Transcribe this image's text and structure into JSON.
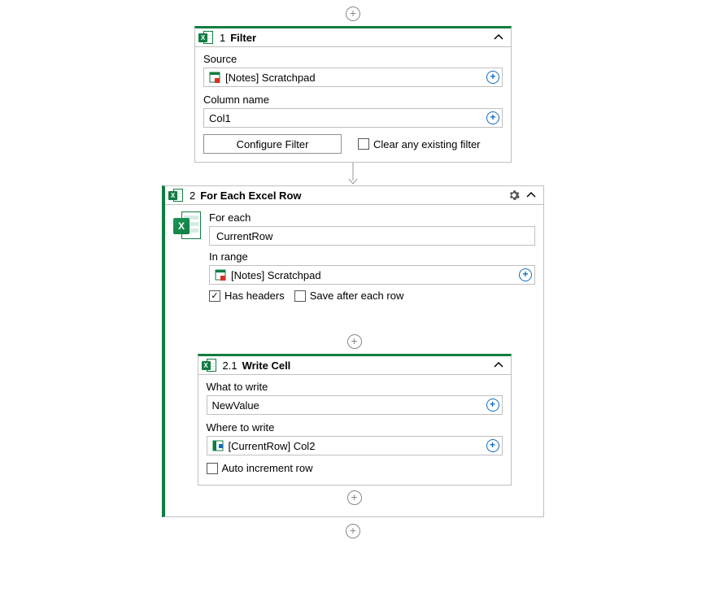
{
  "filter": {
    "number": "1",
    "title": "Filter",
    "source_label": "Source",
    "source_value": "[Notes] Scratchpad",
    "column_label": "Column name",
    "column_value": "Col1",
    "configure_btn": "Configure Filter",
    "clear_checkbox": "Clear any existing filter",
    "clear_checked": false
  },
  "foreach": {
    "number": "2",
    "title": "For Each Excel Row",
    "for_each_label": "For each",
    "for_each_value": "CurrentRow",
    "in_range_label": "In range",
    "in_range_value": "[Notes] Scratchpad",
    "has_headers_label": "Has headers",
    "has_headers_checked": true,
    "save_after_label": "Save after each row",
    "save_after_checked": false
  },
  "writecell": {
    "number": "2.1",
    "title": "Write Cell",
    "what_label": "What to write",
    "what_value": "NewValue",
    "where_label": "Where to write",
    "where_value": "[CurrentRow] Col2",
    "auto_inc_label": "Auto increment row",
    "auto_inc_checked": false
  }
}
